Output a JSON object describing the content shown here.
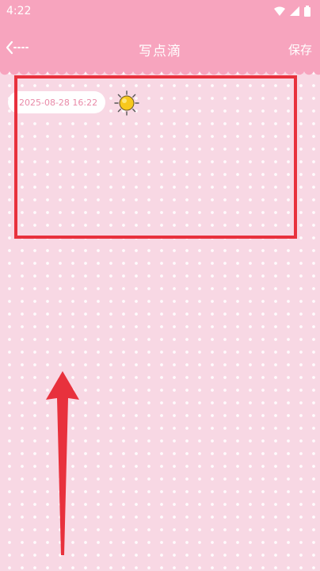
{
  "status_bar": {
    "time": "4:22",
    "icons": [
      "wifi-icon",
      "signal-icon",
      "battery-icon"
    ]
  },
  "app_bar": {
    "back_icon": "back-arrow-icon",
    "title": "写点滴",
    "save_label": "保存"
  },
  "entry": {
    "date": "2025-08-28 16:22",
    "weather_icon": "sun-icon",
    "text": ""
  },
  "colors": {
    "header": "#f7a4be",
    "background": "#f8d8e4",
    "highlight": "#e8313d",
    "date_text": "#e98aa8"
  }
}
